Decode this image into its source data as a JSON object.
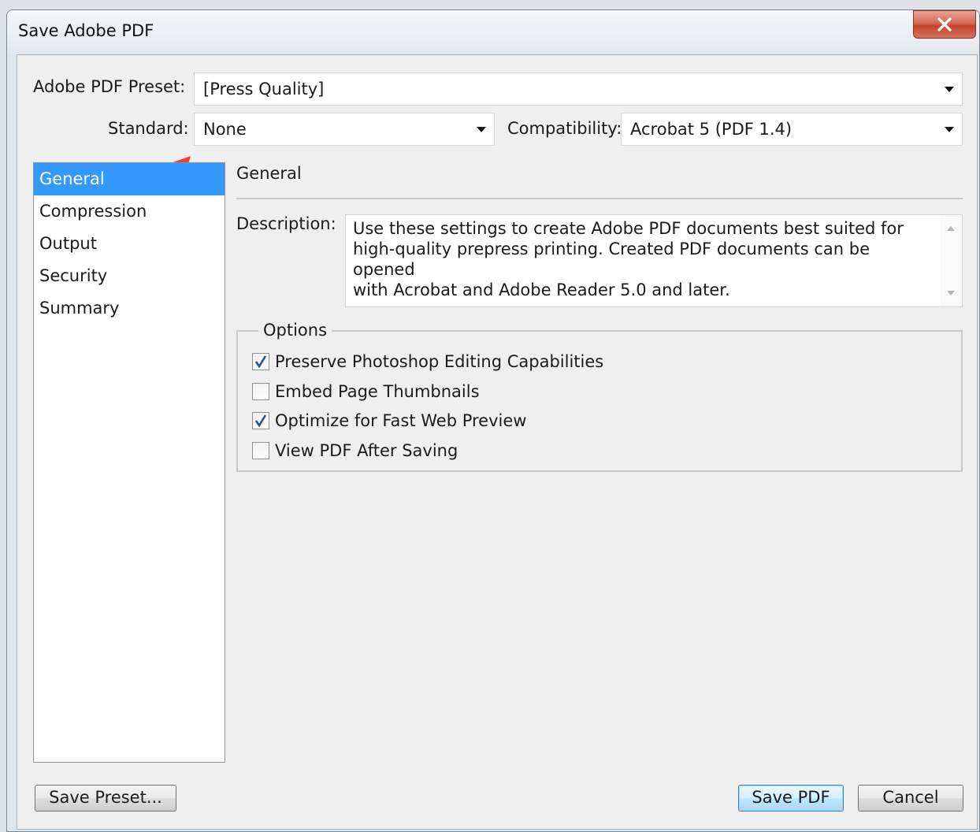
{
  "window": {
    "title": "Save Adobe PDF"
  },
  "preset": {
    "label": "Adobe PDF Preset:",
    "value": "[Press Quality]"
  },
  "standard": {
    "label": "Standard:",
    "value": "None"
  },
  "compatibility": {
    "label": "Compatibility:",
    "value": "Acrobat 5 (PDF 1.4)"
  },
  "sidebar": {
    "items": [
      {
        "label": "General",
        "selected": true
      },
      {
        "label": "Compression"
      },
      {
        "label": "Output"
      },
      {
        "label": "Security"
      },
      {
        "label": "Summary"
      }
    ]
  },
  "panel": {
    "title": "General",
    "description_label": "Description:",
    "description": "Use these settings to create Adobe PDF documents best suited for\nhigh-quality prepress printing.  Created PDF documents can be opened\nwith Acrobat and Adobe Reader 5.0 and later."
  },
  "options": {
    "legend": "Options",
    "items": [
      {
        "label": "Preserve Photoshop Editing Capabilities",
        "checked": true
      },
      {
        "label": "Embed Page Thumbnails",
        "checked": false
      },
      {
        "label": "Optimize for Fast Web Preview",
        "checked": true
      },
      {
        "label": "View PDF After Saving",
        "checked": false
      }
    ]
  },
  "buttons": {
    "save_preset": "Save Preset...",
    "save_pdf": "Save PDF",
    "cancel": "Cancel"
  },
  "colors": {
    "selection": "#3399ff",
    "annotation_arrow": "#e8423a",
    "close_button": "#c7482f"
  }
}
